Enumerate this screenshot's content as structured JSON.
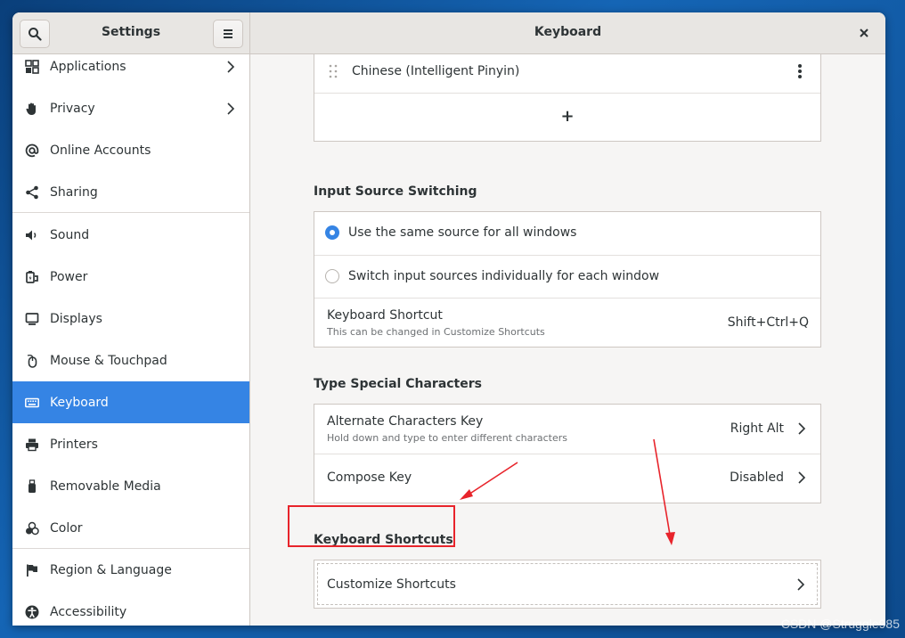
{
  "sidebar": {
    "title": "Settings",
    "items": [
      {
        "label": "Applications",
        "icon": "grid-icon"
      },
      {
        "label": "Privacy",
        "icon": "hand-icon"
      },
      {
        "label": "Online Accounts",
        "icon": "at-icon"
      },
      {
        "label": "Sharing",
        "icon": "share-icon"
      },
      {
        "label": "Sound",
        "icon": "speaker-icon"
      },
      {
        "label": "Power",
        "icon": "plug-icon"
      },
      {
        "label": "Displays",
        "icon": "monitor-icon"
      },
      {
        "label": "Mouse & Touchpad",
        "icon": "mouse-icon"
      },
      {
        "label": "Keyboard",
        "icon": "keyboard-icon"
      },
      {
        "label": "Printers",
        "icon": "printer-icon"
      },
      {
        "label": "Removable Media",
        "icon": "usb-icon"
      },
      {
        "label": "Color",
        "icon": "color-icon"
      },
      {
        "label": "Region & Language",
        "icon": "flag-icon"
      },
      {
        "label": "Accessibility",
        "icon": "accessibility-icon"
      }
    ]
  },
  "header": {
    "title": "Keyboard"
  },
  "input_sources": {
    "items": [
      {
        "label": "Chinese (Intelligent Pinyin)"
      }
    ],
    "add_label": "+"
  },
  "input_source_switching": {
    "title": "Input Source Switching",
    "option_same": "Use the same source for all windows",
    "option_individual": "Switch input sources individually for each window",
    "shortcut_label": "Keyboard Shortcut",
    "shortcut_subtitle": "This can be changed in Customize Shortcuts",
    "shortcut_value": "Shift+Ctrl+Q"
  },
  "special_chars": {
    "title": "Type Special Characters",
    "alt_label": "Alternate Characters Key",
    "alt_subtitle": "Hold down and type to enter different characters",
    "alt_value": "Right Alt",
    "compose_label": "Compose Key",
    "compose_value": "Disabled"
  },
  "keyboard_shortcuts": {
    "title": "Keyboard Shortcuts",
    "customize_label": "Customize Shortcuts"
  },
  "watermark": "CSDN @Struggle985",
  "colors": {
    "accent": "#3584e4",
    "annotation": "#e8242b"
  }
}
